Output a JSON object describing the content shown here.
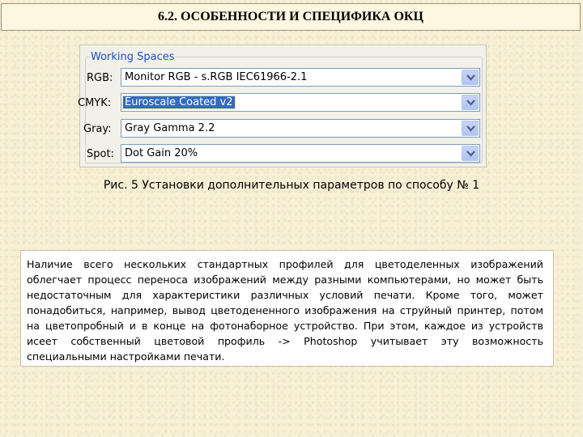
{
  "slide_title": "6.2. ОСОБЕННОСТИ И СПЕЦИФИКА ОКЦ",
  "working_spaces": {
    "title": "Working Spaces",
    "rows": [
      {
        "label": "RGB:",
        "value": "Monitor RGB - s.RGB IEC61966-2.1",
        "selected": false
      },
      {
        "label": "CMYK:",
        "value": "Euroscale Coated v2",
        "selected": true
      },
      {
        "label": "Gray:",
        "value": "Gray Gamma 2.2",
        "selected": false
      },
      {
        "label": "Spot:",
        "value": "Dot Gain 20%",
        "selected": false
      }
    ]
  },
  "caption": "Рис. 5 Установки дополнительных параметров по способу № 1",
  "body_text": "Наличие всего нескольких стандартных профилей для цветоделенных изображений облегчает процесс переноса изображений между разными компьютерами, но может быть недостаточным для характеристики различных условий печати. Кроме того, может понадобиться, например, вывод цветодененного изображения на струйный принтер, потом на цветопробный и в конце на фотонаборное устройство. При этом, каждое из устройств исеет собственный цветовой профиль -> Photoshop учитывает эту возможность специальными настройками печати.",
  "colors": {
    "background": "#f7efd6",
    "accent_blue": "#1d4fc8",
    "selection": "#316ac5"
  }
}
